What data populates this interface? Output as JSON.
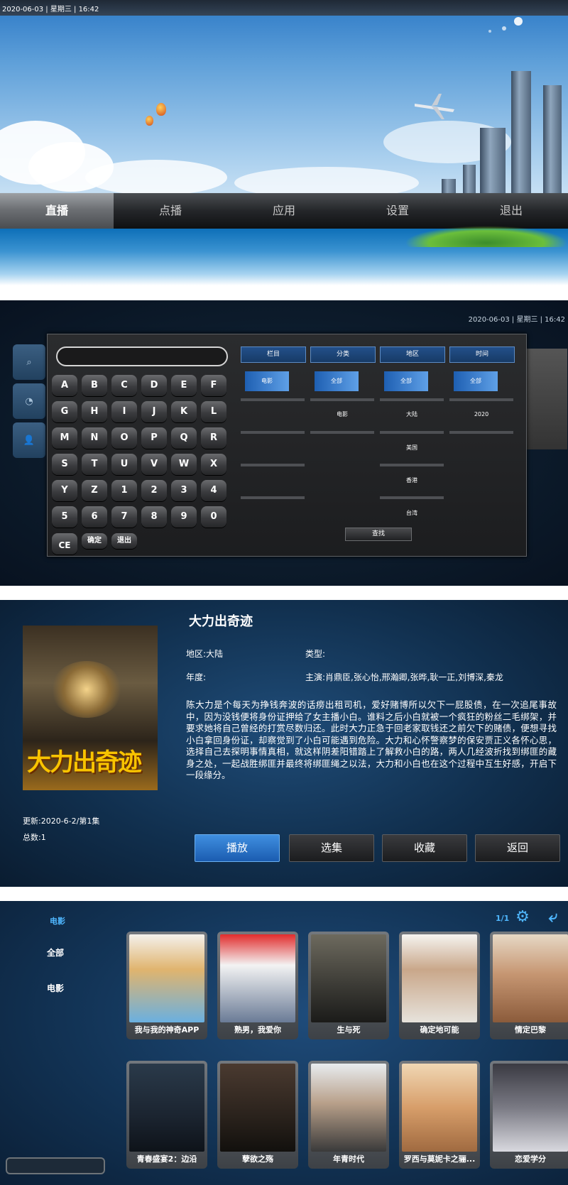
{
  "home": {
    "datetime": "2020-06-03 | 星期三 | 16:42",
    "menu": [
      "直播",
      "点播",
      "应用",
      "设置",
      "退出"
    ]
  },
  "search": {
    "datetime": "2020-06-03 | 星期三 | 16:42",
    "keys": [
      "A",
      "B",
      "C",
      "D",
      "E",
      "F",
      "G",
      "H",
      "I",
      "J",
      "K",
      "L",
      "M",
      "N",
      "O",
      "P",
      "Q",
      "R",
      "S",
      "T",
      "U",
      "V",
      "W",
      "X",
      "Y",
      "Z",
      "1",
      "2",
      "3",
      "4",
      "5",
      "6",
      "7",
      "8",
      "9",
      "0"
    ],
    "bottom_keys": [
      "CE",
      "确定",
      "退出"
    ],
    "columns": [
      "栏目",
      "分类",
      "地区",
      "时间"
    ],
    "col_lanmu": [
      "电影"
    ],
    "col_fenlei": [
      "全部",
      "电影"
    ],
    "col_diqu": [
      "全部",
      "大陆",
      "美国",
      "香港",
      "台湾"
    ],
    "col_shijian": [
      "全部",
      "2020"
    ],
    "find_label": "查找"
  },
  "detail": {
    "title": "大力出奇迹",
    "poster_text": "大力出奇迹",
    "region": "地区:大陆",
    "type": "类型:",
    "year": "年度:",
    "cast": "主演:肖鼎臣,张心怡,邢瀚卿,张晔,耿一正,刘博深,秦龙",
    "description": "陈大力是个每天为挣钱奔波的话痨出租司机，爱好赌博所以欠下一屁股债，在一次追尾事故中，因为没钱便将身份证押给了女主播小白。谁料之后小白就被一个疯狂的粉丝二毛绑架，并要求她将自己曾经的打赏尽数归还。此时大力正急于回老家取钱还之前欠下的赌债，便想寻找小白拿回身份证，却察觉到了小白可能遇到危险。大力和心怀警察梦的保安贾正义各怀心思，选择自己去探明事情真相，就这样阴差阳错踏上了解救小白的路，两人几经波折找到绑匪的藏身之处，一起战胜绑匪并最终将绑匪绳之以法，大力和小白也在这个过程中互生好感，开启下一段缘分。",
    "update": "更新:2020-6-2/第1集",
    "total": "总数:1",
    "buttons": [
      "播放",
      "选集",
      "收藏",
      "返回"
    ]
  },
  "library": {
    "category_title": "电影",
    "categories": [
      "全部",
      "电影"
    ],
    "pager": "1/1",
    "row1": [
      "我与我的神奇APP",
      "熟男，我爱你",
      "生与死",
      "确定地可能",
      "情定巴黎"
    ],
    "row2": [
      "青春盛宴2：边沿",
      "孽欲之殇",
      "年青时代",
      "罗西与莫妮卡之骊...",
      "恋爱学分"
    ]
  },
  "colors": {
    "accent_blue": "#4fb7ff",
    "primary_button": "#1b5cb0",
    "selected_option": "#3f8fe0"
  }
}
